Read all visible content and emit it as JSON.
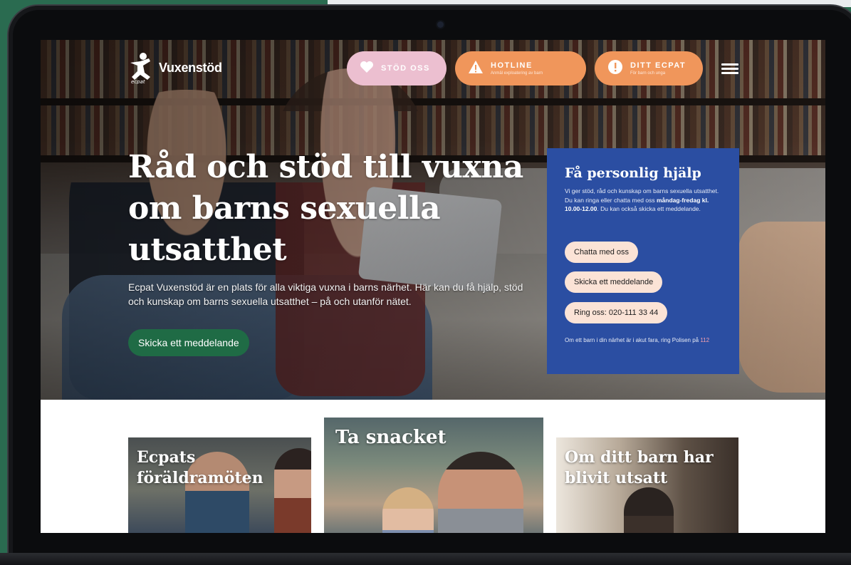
{
  "site": {
    "logo_text": "Vuxenstöd",
    "logo_sub": "ecpat"
  },
  "header": {
    "support_label": "STÖD OSS",
    "hotline_label": "HOTLINE",
    "hotline_sub": "Anmäl exploatering av barn",
    "ecpat_label": "DITT ECPAT",
    "ecpat_sub": "För barn och unga"
  },
  "hero": {
    "title": "Råd och stöd till vuxna om barns sexuella utsatthet",
    "lead": "Ecpat Vuxenstöd är en plats för alla viktiga vuxna i barns närhet. Här kan du få hjälp, stöd och kunskap om barns sexuella utsatthet – på och utanför nätet.",
    "cta": "Skicka ett meddelande"
  },
  "help": {
    "title": "Få personlig hjälp",
    "text_1": "Vi ger stöd, råd och kunskap om barns sexuella utsatthet. Du kan ringa eller chatta med oss ",
    "text_bold": "måndag-fredag kl. 10.00-12.00",
    "text_2": ". Du kan också skicka ett meddelande.",
    "chat_button": "Chatta med oss",
    "message_button": "Skicka ett meddelande",
    "call_button": "Ring oss: 020-111 33 44",
    "note": "Om ett barn i din närhet är i akut fara, ring Polisen på ",
    "note_link": "112"
  },
  "cards": [
    {
      "title": "Ecpats föräldramöten"
    },
    {
      "title": "Ta snacket"
    },
    {
      "title": "Om ditt barn har blivit utsatt"
    }
  ],
  "colors": {
    "support": "#ecbfd0",
    "hotline": "#f0965b",
    "help_panel": "#2b4ea2",
    "cta": "#1f6b45",
    "background": "#2a6b50"
  }
}
